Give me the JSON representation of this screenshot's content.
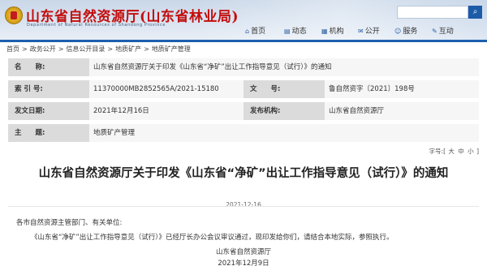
{
  "header": {
    "site_title": "山东省自然资源厅(山东省林业局)",
    "site_subtitle": "Department of Natural Resources of Shandong Province",
    "search_placeholder": "",
    "search_icon": "search-icon",
    "colors": {
      "title": "#c40d0d",
      "accent": "#1d5fae"
    }
  },
  "nav": {
    "items": [
      {
        "icon": "home-icon",
        "glyph": "⌂",
        "label": "首页"
      },
      {
        "icon": "news-icon",
        "glyph": "▤",
        "label": "动态"
      },
      {
        "icon": "building-icon",
        "glyph": "▦",
        "label": "机构"
      },
      {
        "icon": "document-icon",
        "glyph": "✉",
        "label": "公开"
      },
      {
        "icon": "service-icon",
        "glyph": "☺",
        "label": "服务"
      },
      {
        "icon": "interaction-icon",
        "glyph": "✎",
        "label": "互动"
      }
    ]
  },
  "breadcrumb": [
    "首页",
    ">",
    "政务公开",
    ">",
    "信息公开目录",
    ">",
    "地质矿产",
    ">",
    "地质矿产管理"
  ],
  "info": {
    "name_label": "名　　称:",
    "name_value": "山东省自然资源厅关于印发《山东省“净矿”出让工作指导意见（试行）》的通知",
    "index_label": "索 引 号:",
    "index_value": "11370000MB2852565A/2021-15180",
    "docno_label": "文　　号:",
    "docno_value": "鲁自然资字〔2021〕198号",
    "date_label": "发文日期:",
    "date_value": "2021年12月16日",
    "org_label": "发布机构:",
    "org_value": "山东省自然资源厅",
    "topic_label": "主　　题:",
    "topic_value": "地质矿产管理"
  },
  "fontsize": {
    "label": "字号:",
    "open": "[",
    "large": "大",
    "medium": "中",
    "small": "小",
    "close": "]"
  },
  "document": {
    "title": "山东省自然资源厅关于印发《山东省“净矿”出让工作指导意见（试行）》的通知",
    "date": "2021-12-16",
    "salutation": "各市自然资源主管部门、有关单位:",
    "body": "《山东省“净矿”出让工作指导意见（试行）》已经厅长办公会议审议通过，现印发给你们，请结合本地实际，参照执行。",
    "signature": "山东省自然资源厅",
    "signed_date": "2021年12月9日"
  }
}
